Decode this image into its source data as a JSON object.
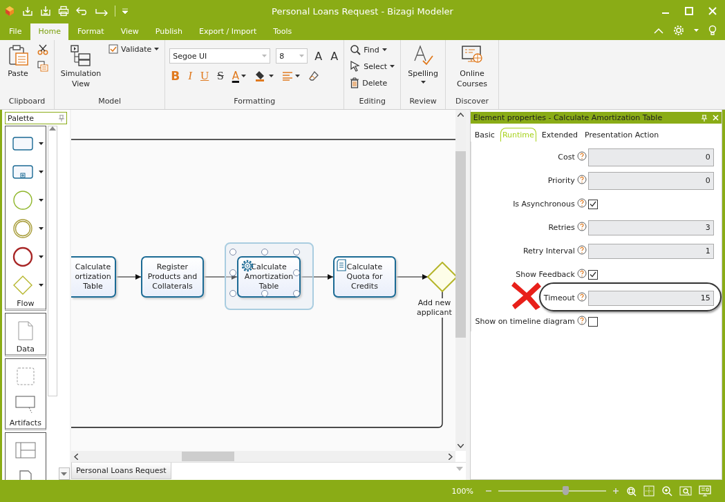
{
  "window": {
    "title": "Personal Loans Request - Bizagi Modeler"
  },
  "menu_tabs": [
    {
      "label": "File",
      "selected": false
    },
    {
      "label": "Home",
      "selected": true
    },
    {
      "label": "Format",
      "selected": false
    },
    {
      "label": "View",
      "selected": false
    },
    {
      "label": "Publish",
      "selected": false
    },
    {
      "label": "Export / Import",
      "selected": false
    },
    {
      "label": "Tools",
      "selected": false
    }
  ],
  "ribbon": {
    "groups": [
      {
        "label": "Clipboard",
        "stacks": [
          {
            "items": [
              {
                "kind": "large",
                "label": "Paste"
              }
            ]
          },
          {
            "items": [
              {
                "kind": "icon"
              },
              {
                "kind": "icon"
              }
            ]
          }
        ]
      },
      {
        "label": "Model",
        "stacks": [
          {
            "items": [
              {
                "kind": "large",
                "label": "Simulation View"
              }
            ]
          },
          {
            "items": [
              {
                "kind": "small",
                "label": "Validate",
                "dropdown": true
              }
            ]
          }
        ]
      },
      {
        "label": "Formatting",
        "bands": [
          {
            "items": [
              {
                "kind": "combo",
                "value": "Segoe UI"
              },
              {
                "kind": "combo",
                "value": "8"
              },
              {
                "kind": "glyph",
                "label": "A"
              },
              {
                "kind": "glyph",
                "label": "A"
              }
            ]
          },
          {
            "items": [
              {
                "kind": "glyph",
                "label": "B"
              },
              {
                "kind": "glyph",
                "label": "I"
              },
              {
                "kind": "glyph",
                "label": "U"
              },
              {
                "kind": "glyph",
                "label": "S"
              },
              {
                "kind": "glyph",
                "label": "A",
                "dropdown": true
              },
              {
                "kind": "icon",
                "dropdown": true
              },
              {
                "kind": "icon",
                "dropdown": true
              },
              {
                "kind": "icon"
              }
            ]
          }
        ]
      },
      {
        "label": "Editing",
        "stacks": [
          {
            "items": [
              {
                "kind": "small",
                "label": "Find",
                "dropdown": true
              },
              {
                "kind": "small",
                "label": "Select",
                "dropdown": true
              },
              {
                "kind": "small",
                "label": "Delete"
              }
            ]
          }
        ]
      },
      {
        "label": "Review",
        "stacks": [
          {
            "items": [
              {
                "kind": "large",
                "label": "Spelling",
                "dropdown": true
              }
            ]
          }
        ]
      },
      {
        "label": "Discover",
        "stacks": [
          {
            "items": [
              {
                "kind": "large",
                "label": "Online Courses"
              }
            ]
          }
        ]
      }
    ]
  },
  "palette": {
    "title": "Palette",
    "sections": [
      {
        "label": "Flow",
        "items": [
          {
            "kind": "task"
          },
          {
            "kind": "subprocess"
          },
          {
            "kind": "start"
          },
          {
            "kind": "intermediate"
          },
          {
            "kind": "end"
          },
          {
            "kind": "gateway"
          }
        ]
      },
      {
        "label": "Data",
        "items": [
          {
            "kind": "document"
          }
        ]
      },
      {
        "label": "Artifacts",
        "items": [
          {
            "kind": "group"
          },
          {
            "kind": "annotation"
          }
        ]
      },
      {
        "items": [
          {
            "kind": "lanes"
          },
          {
            "kind": "pool"
          }
        ]
      }
    ]
  },
  "diagram": {
    "nodes": [
      {
        "kind": "task",
        "lines": [
          "Calculate",
          "ortization",
          "Table"
        ],
        "selected": false
      },
      {
        "kind": "task",
        "lines": [
          "Register",
          "Products and",
          "Collaterals"
        ],
        "selected": false
      },
      {
        "kind": "service_task",
        "lines": [
          "Calculate",
          "Amortization",
          "Table"
        ],
        "selected": true
      },
      {
        "kind": "script_task",
        "lines": [
          "Calculate",
          "Quota for",
          "Credits"
        ],
        "selected": false
      },
      {
        "kind": "gateway",
        "lines": [
          "Add new",
          "applicant"
        ],
        "selected": false
      }
    ],
    "tabs": [
      {
        "label": "Personal Loans Request",
        "selected": true
      }
    ]
  },
  "properties": {
    "title": "Element properties - Calculate Amortization Table",
    "tabs": [
      {
        "label": "Basic",
        "selected": false
      },
      {
        "label": "Runtime",
        "selected": true
      },
      {
        "label": "Extended",
        "selected": false
      },
      {
        "label": "Presentation Action",
        "selected": false
      }
    ],
    "rows": [
      {
        "kind": "number",
        "label": "Cost",
        "value": "0",
        "highlighted": false
      },
      {
        "kind": "number",
        "label": "Priority",
        "value": "0",
        "highlighted": false
      },
      {
        "kind": "check",
        "label": "Is Asynchronous",
        "checked": true,
        "highlighted": false
      },
      {
        "kind": "number",
        "label": "Retries",
        "value": "3",
        "highlighted": false
      },
      {
        "kind": "number",
        "label": "Retry Interval",
        "value": "1",
        "highlighted": false
      },
      {
        "kind": "check",
        "label": "Show Feedback",
        "checked": true,
        "highlighted": false
      },
      {
        "kind": "number",
        "label": "Timeout",
        "value": "15",
        "highlighted": true
      },
      {
        "kind": "check",
        "label": "Show on timeline diagram",
        "checked": false,
        "highlighted": false
      }
    ]
  },
  "status_bar": {
    "zoom": "100%",
    "zoom_slider": {
      "level": 0.62
    }
  }
}
